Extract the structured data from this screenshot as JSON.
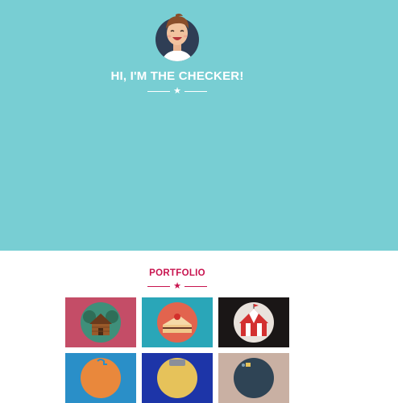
{
  "hero": {
    "title": "HI, I'M THE CHECKER!",
    "background": "#78ced3",
    "avatar_icon": "avatar-smiling-man",
    "divider_icon": "star-icon"
  },
  "portfolio": {
    "title": "PORTFOLIO",
    "accent": "#c8144f",
    "divider_icon": "star-icon",
    "items": [
      {
        "icon": "log-cabin-icon",
        "background": "#c44d67"
      },
      {
        "icon": "cake-slice-icon",
        "background": "#2aa6b8"
      },
      {
        "icon": "circus-tent-icon",
        "background": "#1a1616"
      },
      {
        "icon": "puzzle-icon",
        "background": "#2a8fc8"
      },
      {
        "icon": "jar-icon",
        "background": "#1d35a8"
      },
      {
        "icon": "gadget-icon",
        "background": "#c9b0a3"
      }
    ]
  }
}
